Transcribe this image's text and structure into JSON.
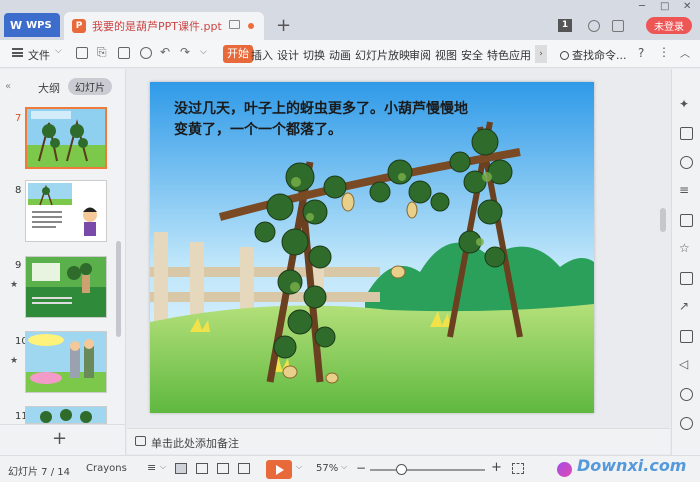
{
  "titlebar": {
    "app_tab": "WPS",
    "doc_tab_icon": "P",
    "doc_tab_title": "我要的是葫芦PPT课件.ppt",
    "new_tab": "+",
    "badge": "1",
    "login_label": "未登录",
    "window_controls": [
      "─",
      "□",
      "✕"
    ]
  },
  "menubar": {
    "file_label": "文件",
    "start_label": "开始",
    "items": [
      "插入",
      "设计",
      "切换",
      "动画",
      "幻灯片放映",
      "审阅",
      "视图",
      "安全",
      "特色应用"
    ],
    "search_label": "查找命令...",
    "help": "?",
    "more": "⋮",
    "collapse": "︿"
  },
  "leftpanel": {
    "collapse": "«",
    "tab_outline": "大纲",
    "tab_slides": "幻灯片",
    "slides": [
      {
        "num": "7",
        "active": true,
        "star": ""
      },
      {
        "num": "8",
        "active": false,
        "star": ""
      },
      {
        "num": "9",
        "active": false,
        "star": "★"
      },
      {
        "num": "10",
        "active": false,
        "star": "★"
      },
      {
        "num": "11",
        "active": false,
        "star": ""
      }
    ],
    "add": "+"
  },
  "slide": {
    "text": "没过几天，叶子上的蚜虫更多了。小葫芦慢慢地变黄了，一个一个都落了。"
  },
  "notes": {
    "placeholder": "单击此处添加备注"
  },
  "statusbar": {
    "slide_info": "幻灯片 7 / 14",
    "theme": "Crayons",
    "zoom": "57%",
    "zoom_minus": "−",
    "zoom_plus": "+",
    "watermark": "Downxi.com",
    "zoom_level_fraction": 0.57
  },
  "colors": {
    "accent": "#e86a3a",
    "brand_blue": "#3d6dcc",
    "login_red": "#e55555"
  }
}
